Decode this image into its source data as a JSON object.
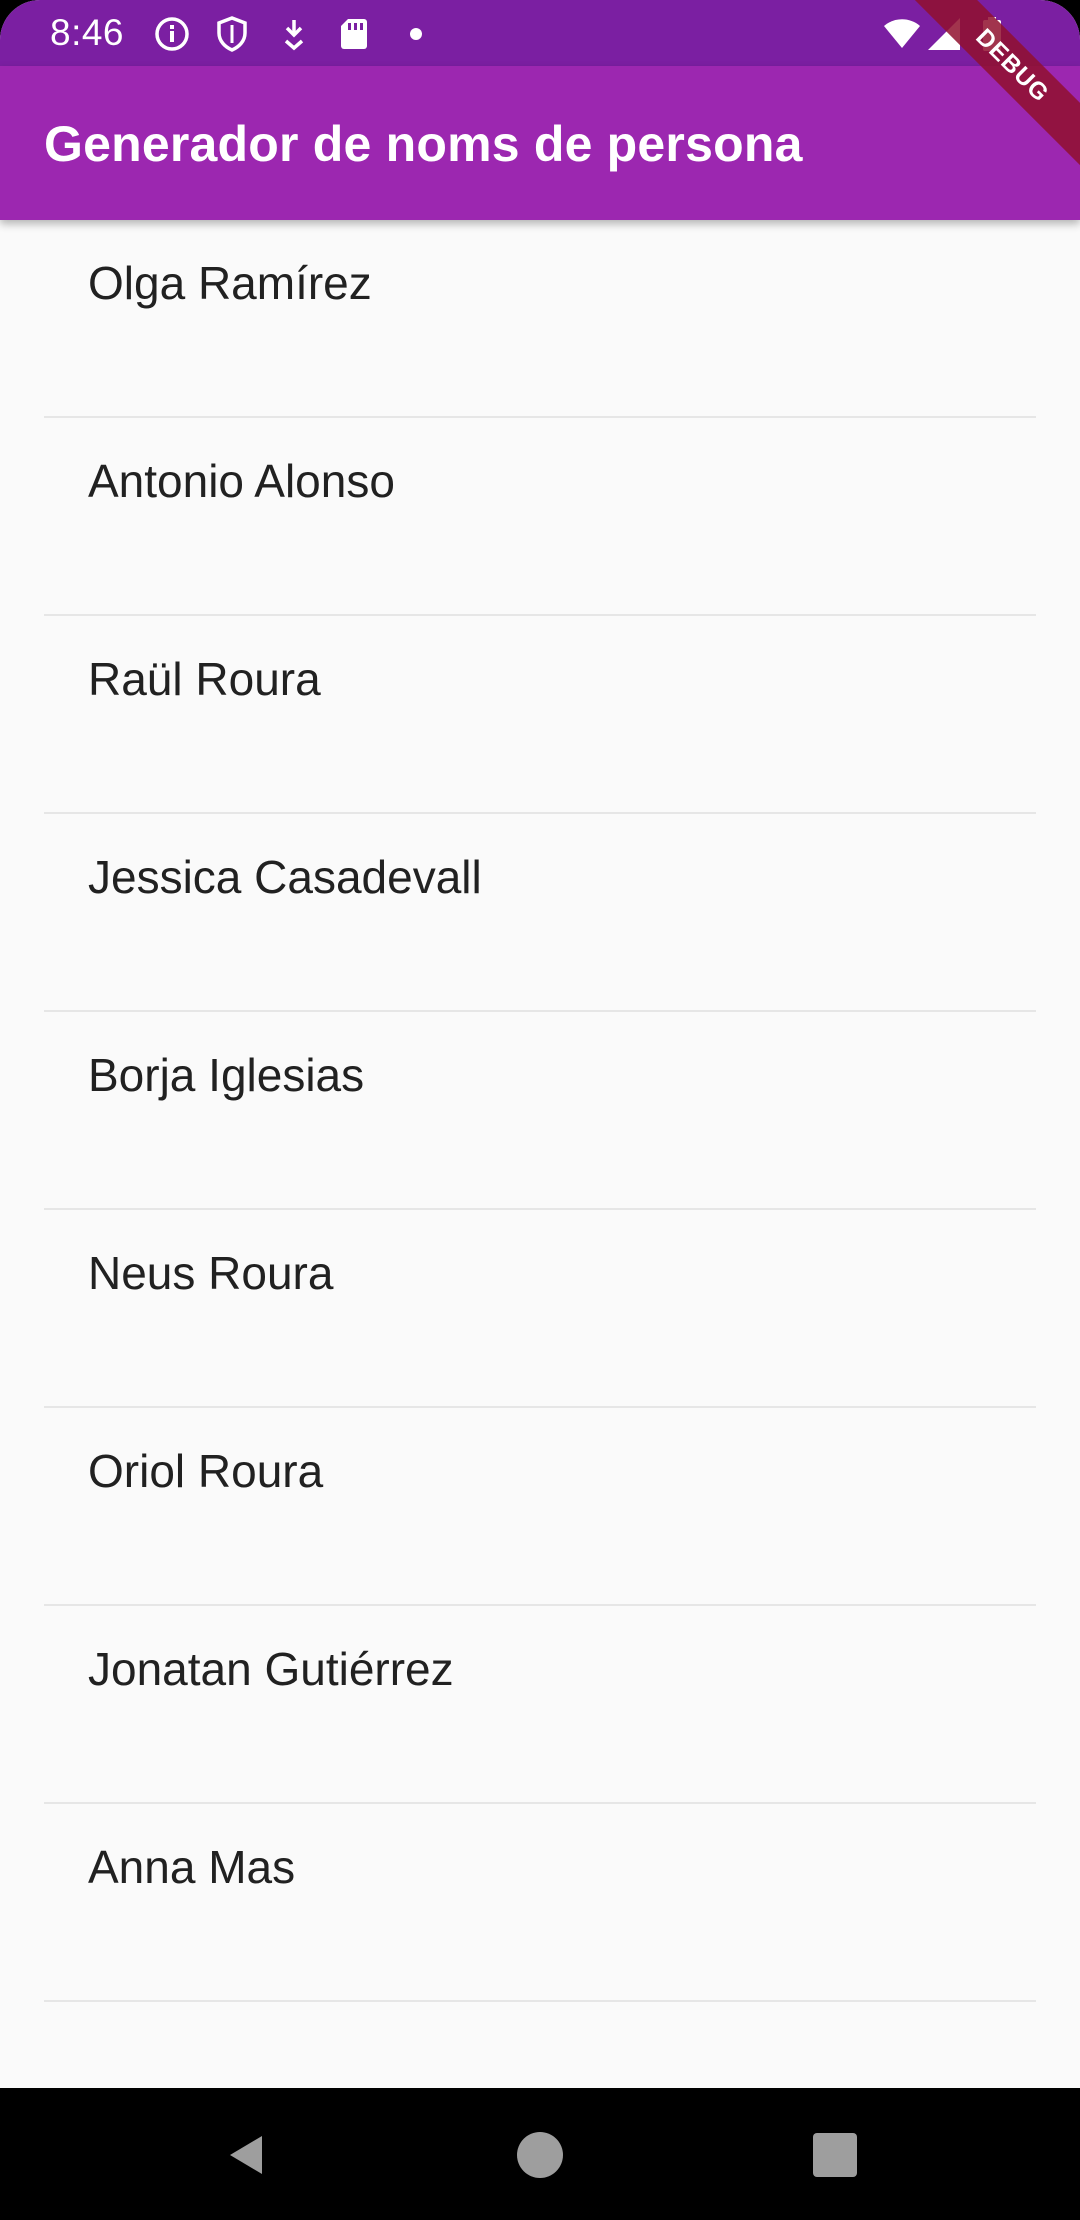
{
  "status_bar": {
    "time": "8:46",
    "left_icons": [
      "info-icon",
      "shield-icon",
      "download-icon",
      "sd-card-icon",
      "dot-icon"
    ],
    "right_icons": [
      "wifi-icon",
      "signal-icon",
      "battery-icon"
    ],
    "background": "#7b1fa2"
  },
  "app_bar": {
    "title": "Generador de noms de persona",
    "background": "#9c27b0"
  },
  "debug_banner": {
    "label": "DEBUG",
    "color": "#91112e"
  },
  "names": [
    "Olga Ramírez",
    "Antonio Alonso",
    "Raül Roura",
    "Jessica Casadevall",
    "Borja Iglesias",
    "Neus Roura",
    "Oriol Roura",
    "Jonatan Gutiérrez",
    "Anna Mas"
  ],
  "nav_bar": {
    "buttons": [
      "back-icon",
      "home-icon",
      "recents-icon"
    ],
    "icon_color": "#9e9e9e"
  }
}
